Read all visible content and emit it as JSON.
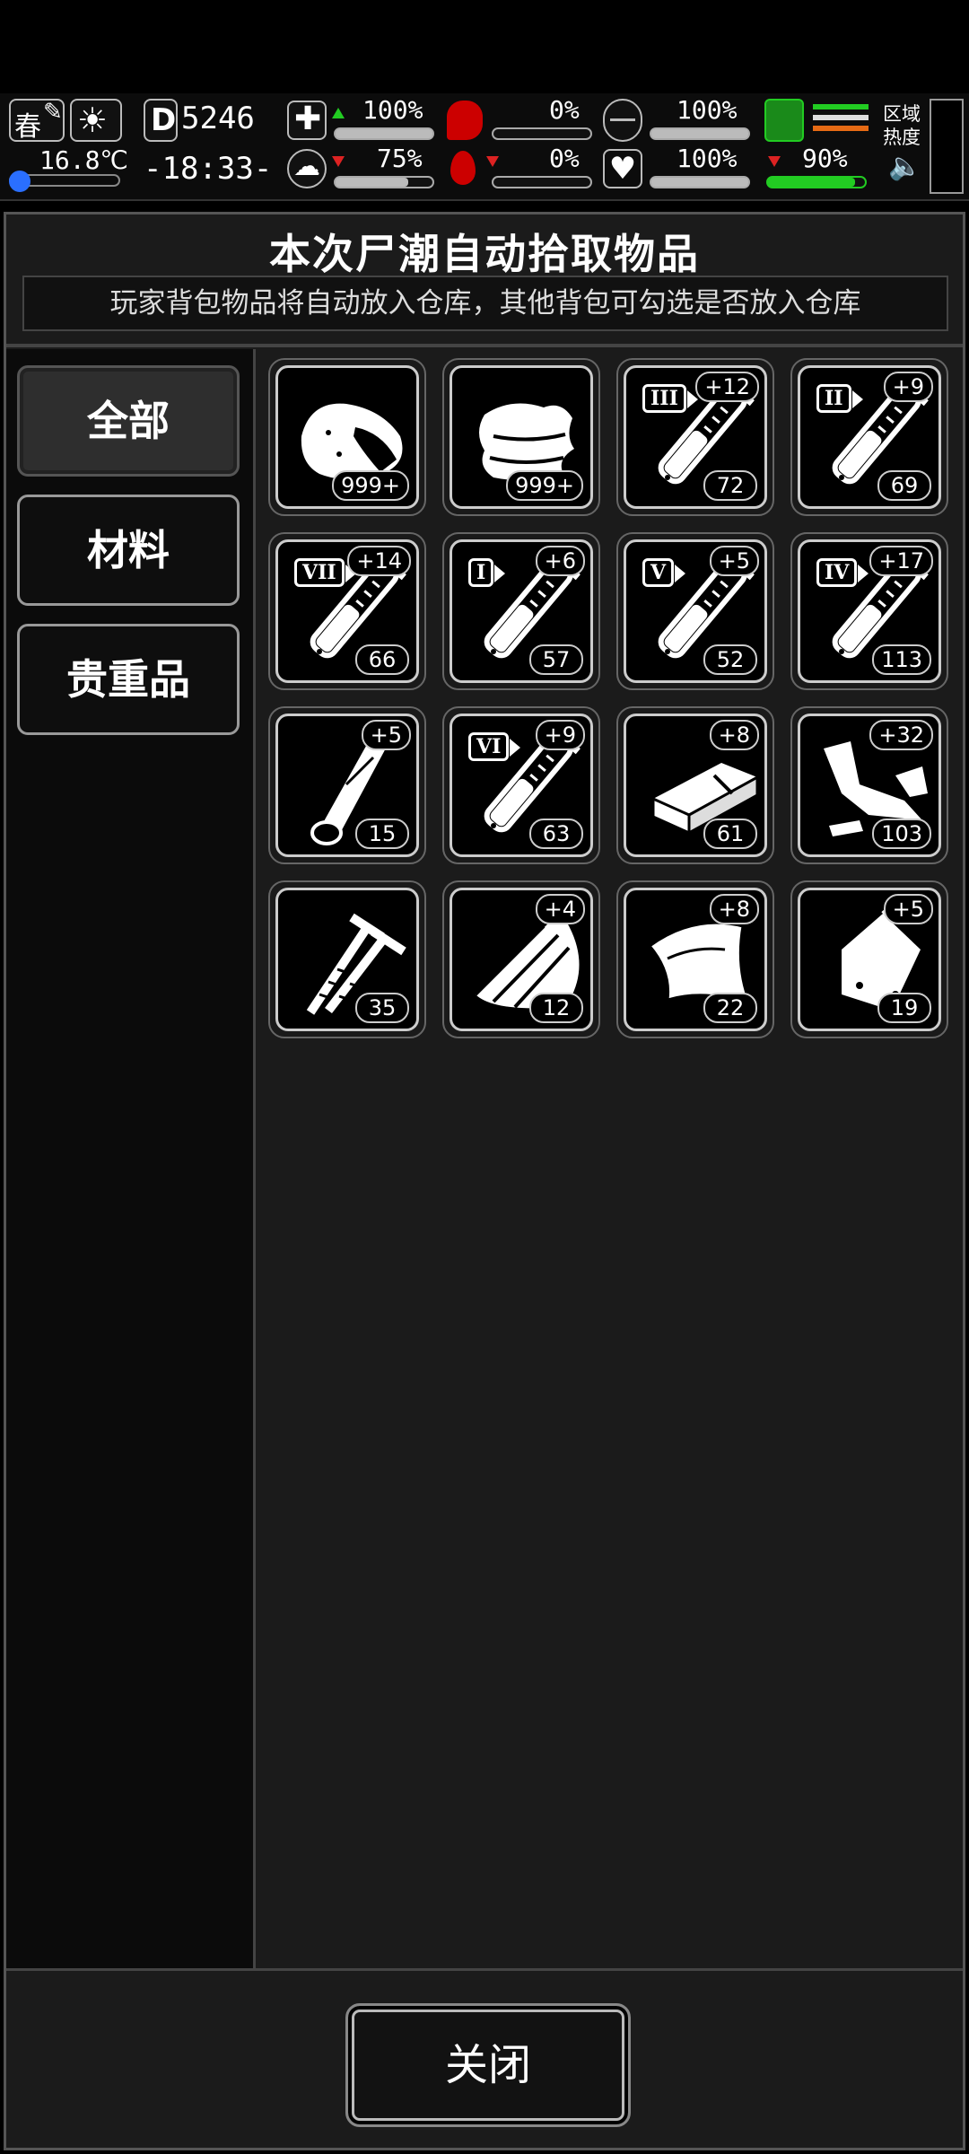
{
  "hud": {
    "season": "春",
    "temperature": "16.8℃",
    "day": "5246",
    "time": "-18:33-",
    "region_label": "区域\n热度",
    "stats": [
      {
        "name": "health",
        "pct": "100%",
        "level": 1.0,
        "trend": "up"
      },
      {
        "name": "hunger",
        "pct": "0%",
        "level": 0.0,
        "trend": "none"
      },
      {
        "name": "energy",
        "pct": "100%",
        "level": 1.0,
        "trend": "none"
      },
      {
        "name": "sanity",
        "pct": "75%",
        "level": 0.75,
        "trend": "down"
      },
      {
        "name": "thirst",
        "pct": "0%",
        "level": 0.0,
        "trend": "down"
      },
      {
        "name": "mood",
        "pct": "100%",
        "level": 1.0,
        "trend": "none"
      },
      {
        "name": "stamina",
        "pct": "90%",
        "level": 0.9,
        "trend": "down"
      }
    ],
    "colors": {
      "stamina_bar": "#22cc22",
      "trend_up": "#22cc22",
      "trend_down": "#dd2222",
      "hunger_icon": "#dd1111"
    }
  },
  "panel": {
    "title": "本次尸潮自动拾取物品",
    "subtitle": "玩家背包物品将自动放入仓库，其他背包可勾选是否放入仓库"
  },
  "categories": [
    {
      "label": "全部",
      "active": true
    },
    {
      "label": "材料",
      "active": false
    },
    {
      "label": "贵重品",
      "active": false
    }
  ],
  "items": [
    {
      "icon": "meat-icon",
      "count": "999+",
      "bonus": "",
      "tier": ""
    },
    {
      "icon": "cloth-icon",
      "count": "999+",
      "bonus": "",
      "tier": ""
    },
    {
      "icon": "test-tube-icon",
      "count": "72",
      "bonus": "+12",
      "tier": "III"
    },
    {
      "icon": "test-tube-icon",
      "count": "69",
      "bonus": "+9",
      "tier": "II"
    },
    {
      "icon": "test-tube-icon",
      "count": "66",
      "bonus": "+14",
      "tier": "VII"
    },
    {
      "icon": "test-tube-icon",
      "count": "57",
      "bonus": "+6",
      "tier": "I"
    },
    {
      "icon": "test-tube-icon",
      "count": "52",
      "bonus": "+5",
      "tier": "V"
    },
    {
      "icon": "test-tube-icon",
      "count": "113",
      "bonus": "+17",
      "tier": "IV"
    },
    {
      "icon": "wood-log-icon",
      "count": "15",
      "bonus": "+5",
      "tier": ""
    },
    {
      "icon": "test-tube-icon",
      "count": "63",
      "bonus": "+9",
      "tier": "VI"
    },
    {
      "icon": "metal-plate-icon",
      "count": "61",
      "bonus": "+8",
      "tier": ""
    },
    {
      "icon": "scrap-parts-icon",
      "count": "103",
      "bonus": "+32",
      "tier": ""
    },
    {
      "icon": "nails-icon",
      "count": "35",
      "bonus": "",
      "tier": ""
    },
    {
      "icon": "wood-planks-icon",
      "count": "12",
      "bonus": "+4",
      "tier": ""
    },
    {
      "icon": "leather-icon",
      "count": "22",
      "bonus": "+8",
      "tier": ""
    },
    {
      "icon": "plastic-bag-icon",
      "count": "19",
      "bonus": "+5",
      "tier": ""
    }
  ],
  "footer": {
    "close_label": "关闭"
  }
}
